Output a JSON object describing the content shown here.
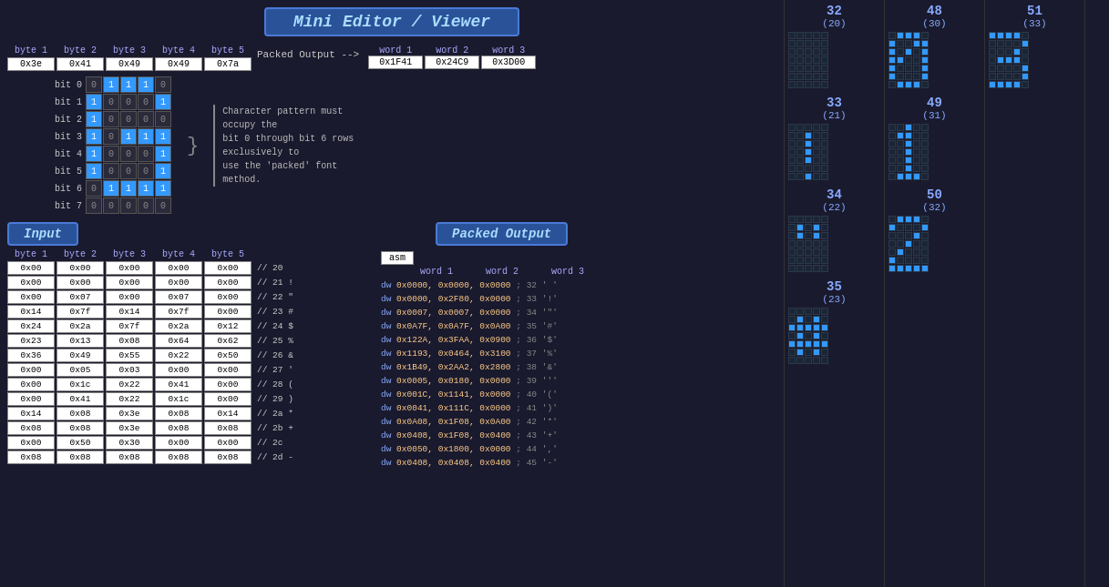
{
  "title": "Mini Editor / Viewer",
  "top": {
    "byte_headers": [
      "byte 1",
      "byte 2",
      "byte 3",
      "byte 4",
      "byte 5"
    ],
    "byte_values": [
      "0x3e",
      "0x41",
      "0x49",
      "0x49",
      "0x7a"
    ],
    "packed_label": "Packed Output -->",
    "word_headers": [
      "word 1",
      "word 2",
      "word 3"
    ],
    "word_values": [
      "0x1F41",
      "0x24C9",
      "0x3D00"
    ]
  },
  "bit_grid": {
    "rows": [
      {
        "label": "bit 0",
        "cells": [
          0,
          1,
          1,
          1,
          0
        ]
      },
      {
        "label": "bit 1",
        "cells": [
          1,
          0,
          0,
          0,
          1
        ]
      },
      {
        "label": "bit 2",
        "cells": [
          1,
          0,
          0,
          0,
          0
        ]
      },
      {
        "label": "bit 3",
        "cells": [
          1,
          0,
          1,
          1,
          1
        ]
      },
      {
        "label": "bit 4",
        "cells": [
          1,
          0,
          0,
          0,
          1
        ]
      },
      {
        "label": "bit 5",
        "cells": [
          1,
          0,
          0,
          0,
          1
        ]
      },
      {
        "label": "bit 6",
        "cells": [
          0,
          1,
          1,
          1,
          1
        ]
      },
      {
        "label": "bit 7",
        "cells": [
          0,
          0,
          0,
          0,
          0
        ]
      }
    ],
    "annotation": "Character pattern must occupy the bit 0 through bit 6 rows exclusively to use the 'packed' font method."
  },
  "input_label": "Input",
  "packed_output_label": "Packed Output",
  "input_table": {
    "headers": [
      "byte 1",
      "byte 2",
      "byte 3",
      "byte 4",
      "byte 5"
    ],
    "rows": [
      [
        "0x00",
        "0x00",
        "0x00",
        "0x00",
        "0x00",
        "// 20"
      ],
      [
        "0x00",
        "0x00",
        "0x00",
        "0x00",
        "0x00",
        "// 21 !"
      ],
      [
        "0x00",
        "0x07",
        "0x00",
        "0x07",
        "0x00",
        "// 22 \""
      ],
      [
        "0x14",
        "0x7f",
        "0x14",
        "0x7f",
        "0x00",
        "// 23 #"
      ],
      [
        "0x24",
        "0x2a",
        "0x7f",
        "0x2a",
        "0x12",
        "// 24 $"
      ],
      [
        "0x23",
        "0x13",
        "0x08",
        "0x64",
        "0x62",
        "// 25 %"
      ],
      [
        "0x36",
        "0x49",
        "0x55",
        "0x22",
        "0x50",
        "// 26 &"
      ],
      [
        "0x00",
        "0x05",
        "0x03",
        "0x00",
        "0x00",
        "// 27 '"
      ],
      [
        "0x00",
        "0x1c",
        "0x22",
        "0x41",
        "0x00",
        "// 28 ("
      ],
      [
        "0x00",
        "0x41",
        "0x22",
        "0x1c",
        "0x00",
        "// 29 )"
      ],
      [
        "0x14",
        "0x08",
        "0x3e",
        "0x08",
        "0x14",
        "// 2a *"
      ],
      [
        "0x08",
        "0x08",
        "0x3e",
        "0x08",
        "0x08",
        "// 2b +"
      ],
      [
        "0x00",
        "0x50",
        "0x30",
        "0x00",
        "0x00",
        "// 2c"
      ],
      [
        "0x08",
        "0x08",
        "0x08",
        "0x08",
        "0x08",
        "// 2d -"
      ]
    ]
  },
  "asm_tab": "asm",
  "output_table": {
    "word_headers": [
      "word 1",
      "word 2",
      "word 3"
    ],
    "rows": [
      "dw 0x0000, 0x0000, 0x0000 ; 32 ' '",
      "dw 0x0000, 0x2F80, 0x0000 ; 33 '!'",
      "dw 0x0007, 0x0007, 0x0000 ; 34 '\"'",
      "dw 0x0A7F, 0x0A7F, 0x0A00 ; 35 '#'",
      "dw 0x122A, 0x3FAA, 0x0900 ; 36 '$'",
      "dw 0x1193, 0x0464, 0x3100 ; 37 '%'",
      "dw 0x1B49, 0x2AA2, 0x2800 ; 38 '&'",
      "dw 0x0005, 0x0180, 0x0000 ; 39 '''",
      "dw 0x001C, 0x1141, 0x0000 ; 40 '('",
      "dw 0x0041, 0x111C, 0x0000 ; 41 ')'",
      "dw 0x0A08, 0x1F08, 0x0A00 ; 42 '*'",
      "dw 0x0408, 0x1F08, 0x0400 ; 43 '+'",
      "dw 0x0050, 0x1800, 0x0000 ; 44 ','",
      "dw 0x0408, 0x0408, 0x0400 ; 45 '-'"
    ]
  },
  "right_chars": [
    {
      "num": "32",
      "paren": "(20)",
      "grid": [
        [
          0,
          0,
          0,
          0,
          0
        ],
        [
          0,
          0,
          0,
          0,
          0
        ],
        [
          0,
          0,
          0,
          0,
          0
        ],
        [
          0,
          0,
          0,
          0,
          0
        ],
        [
          0,
          0,
          0,
          0,
          0
        ],
        [
          0,
          0,
          0,
          0,
          0
        ],
        [
          0,
          0,
          0,
          0,
          0
        ]
      ]
    },
    {
      "num": "33",
      "paren": "(21)",
      "grid": [
        [
          0,
          0,
          0,
          0,
          0
        ],
        [
          0,
          0,
          1,
          0,
          0
        ],
        [
          0,
          0,
          1,
          0,
          0
        ],
        [
          0,
          0,
          1,
          0,
          0
        ],
        [
          0,
          0,
          1,
          0,
          0
        ],
        [
          0,
          0,
          0,
          0,
          0
        ],
        [
          0,
          0,
          1,
          0,
          0
        ]
      ]
    },
    {
      "num": "34",
      "paren": "(22)",
      "grid": [
        [
          0,
          0,
          0,
          0,
          0
        ],
        [
          0,
          1,
          0,
          1,
          0
        ],
        [
          0,
          1,
          0,
          1,
          0
        ],
        [
          0,
          0,
          0,
          0,
          0
        ],
        [
          0,
          0,
          0,
          0,
          0
        ],
        [
          0,
          0,
          0,
          0,
          0
        ],
        [
          0,
          0,
          0,
          0,
          0
        ]
      ]
    },
    {
      "num": "48",
      "paren": "(30)",
      "grid": [
        [
          0,
          1,
          1,
          1,
          0
        ],
        [
          1,
          0,
          0,
          1,
          1
        ],
        [
          1,
          0,
          1,
          0,
          1
        ],
        [
          1,
          1,
          0,
          0,
          1
        ],
        [
          1,
          0,
          0,
          0,
          1
        ],
        [
          1,
          0,
          0,
          0,
          1
        ],
        [
          0,
          1,
          1,
          1,
          0
        ]
      ]
    },
    {
      "num": "49",
      "paren": "(31)",
      "grid": [
        [
          0,
          0,
          1,
          0,
          0
        ],
        [
          0,
          1,
          1,
          0,
          0
        ],
        [
          0,
          0,
          1,
          0,
          0
        ],
        [
          0,
          0,
          1,
          0,
          0
        ],
        [
          0,
          0,
          1,
          0,
          0
        ],
        [
          0,
          0,
          1,
          0,
          0
        ],
        [
          0,
          1,
          1,
          1,
          0
        ]
      ]
    },
    {
      "num": "50",
      "paren": "(32)",
      "grid": [
        [
          0,
          1,
          1,
          1,
          0
        ],
        [
          1,
          0,
          0,
          0,
          1
        ],
        [
          0,
          0,
          0,
          1,
          0
        ],
        [
          0,
          0,
          1,
          0,
          0
        ],
        [
          0,
          1,
          0,
          0,
          0
        ],
        [
          1,
          0,
          0,
          0,
          0
        ],
        [
          1,
          1,
          1,
          1,
          1
        ]
      ]
    },
    {
      "num": "35",
      "paren": "(23)",
      "grid": [
        [
          0,
          0,
          0,
          0,
          0
        ],
        [
          0,
          1,
          0,
          1,
          0
        ],
        [
          1,
          1,
          1,
          1,
          1
        ],
        [
          0,
          1,
          0,
          1,
          0
        ],
        [
          1,
          1,
          1,
          1,
          1
        ],
        [
          0,
          1,
          0,
          1,
          0
        ],
        [
          0,
          0,
          0,
          0,
          0
        ]
      ]
    },
    {
      "num": "51",
      "paren": "(33)",
      "grid": [
        [
          1,
          1,
          1,
          1,
          0
        ],
        [
          0,
          0,
          0,
          0,
          1
        ],
        [
          0,
          0,
          0,
          1,
          0
        ],
        [
          0,
          1,
          1,
          1,
          0
        ],
        [
          0,
          0,
          0,
          0,
          1
        ],
        [
          0,
          0,
          0,
          0,
          1
        ],
        [
          1,
          1,
          1,
          1,
          0
        ]
      ]
    }
  ]
}
